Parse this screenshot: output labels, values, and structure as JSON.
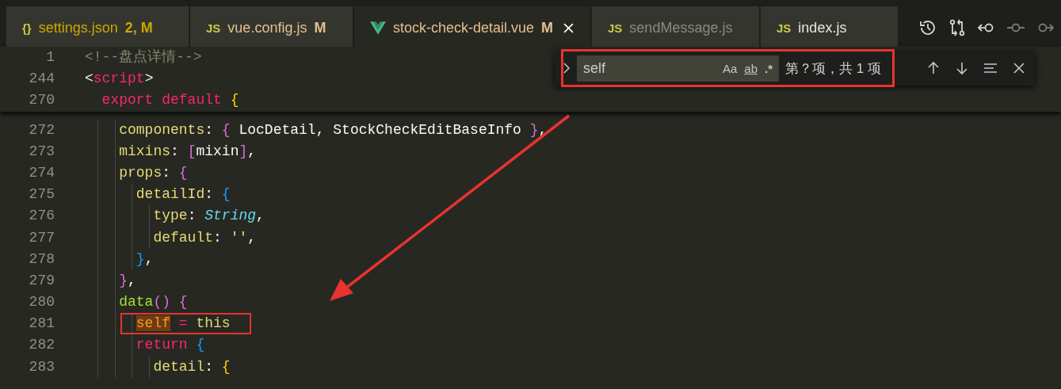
{
  "tabs": [
    {
      "icon": "{}",
      "kind": "json",
      "label": "settings.json",
      "badge": "2, M",
      "color": "#cca700",
      "selected": false
    },
    {
      "icon": "JS",
      "kind": "js",
      "label": "vue.config.js",
      "badge": "M",
      "color": "#e2c08d",
      "selected": false
    },
    {
      "kind": "vue",
      "label": "stock-check-detail.vue",
      "badge": "M",
      "color": "#e2c08d",
      "selected": true
    },
    {
      "icon": "JS",
      "kind": "js",
      "label": "sendMessage.js",
      "color": "#8a8a85",
      "selected": false
    },
    {
      "icon": "JS",
      "kind": "js",
      "label": "index.js",
      "color": "#e8e8e2",
      "selected": false
    }
  ],
  "toolbar": [
    {
      "kind": "history",
      "disabled": false
    },
    {
      "kind": "compare",
      "disabled": false
    },
    {
      "kind": "back",
      "disabled": false
    },
    {
      "kind": "commit",
      "disabled": true
    },
    {
      "kind": "forward",
      "disabled": true
    }
  ],
  "sticky_lines": [
    {
      "number": "1",
      "tokens": [
        {
          "kind": "comment",
          "text": "<!--盘点详情-->"
        }
      ]
    },
    {
      "number": "244",
      "tokens": [
        {
          "kind": "plain",
          "text": "<"
        },
        {
          "kind": "keyword",
          "text": "script"
        },
        {
          "kind": "plain",
          "text": ">"
        }
      ]
    },
    {
      "number": "270",
      "tokens": [
        {
          "kind": "keyword",
          "text": "  export default "
        },
        {
          "kind": "bracket1",
          "text": "{"
        }
      ]
    }
  ],
  "lines": [
    {
      "number": "272",
      "tokens": [
        {
          "kind": "property",
          "text": "    components"
        },
        {
          "kind": "plain",
          "text": ": "
        },
        {
          "kind": "bracket2",
          "text": "{"
        },
        {
          "kind": "plain",
          "text": " LocDetail, StockCheckEditBaseInfo "
        },
        {
          "kind": "bracket2",
          "text": "}"
        },
        {
          "kind": "plain",
          "text": ","
        }
      ]
    },
    {
      "number": "273",
      "tokens": [
        {
          "kind": "property",
          "text": "    mixins"
        },
        {
          "kind": "plain",
          "text": ": "
        },
        {
          "kind": "bracket2",
          "text": "["
        },
        {
          "kind": "plain",
          "text": "mixin"
        },
        {
          "kind": "bracket2",
          "text": "]"
        },
        {
          "kind": "plain",
          "text": ","
        }
      ]
    },
    {
      "number": "274",
      "tokens": [
        {
          "kind": "property",
          "text": "    props"
        },
        {
          "kind": "plain",
          "text": ": "
        },
        {
          "kind": "bracket2",
          "text": "{"
        }
      ]
    },
    {
      "number": "275",
      "tokens": [
        {
          "kind": "property",
          "text": "      detailId"
        },
        {
          "kind": "plain",
          "text": ": "
        },
        {
          "kind": "bracket3",
          "text": "{"
        }
      ]
    },
    {
      "number": "276",
      "tokens": [
        {
          "kind": "property",
          "text": "        type"
        },
        {
          "kind": "plain",
          "text": ": "
        },
        {
          "kind": "type",
          "text": "String"
        },
        {
          "kind": "plain",
          "text": ","
        }
      ]
    },
    {
      "number": "277",
      "tokens": [
        {
          "kind": "property",
          "text": "        default"
        },
        {
          "kind": "plain",
          "text": ": "
        },
        {
          "kind": "string",
          "text": "''"
        },
        {
          "kind": "plain",
          "text": ","
        }
      ]
    },
    {
      "number": "278",
      "tokens": [
        {
          "kind": "bracket3",
          "text": "      }"
        },
        {
          "kind": "plain",
          "text": ","
        }
      ]
    },
    {
      "number": "279",
      "tokens": [
        {
          "kind": "bracket2",
          "text": "    }"
        },
        {
          "kind": "plain",
          "text": ","
        }
      ]
    },
    {
      "number": "280",
      "tokens": [
        {
          "kind": "function",
          "text": "    data"
        },
        {
          "kind": "bracket2",
          "text": "()"
        },
        {
          "kind": "bracket2",
          "text": " {"
        }
      ]
    },
    {
      "number": "281",
      "annotated": true,
      "tokens": [
        {
          "kind": "match",
          "text": "      self"
        },
        {
          "kind": "keyword",
          "text": " = "
        },
        {
          "kind": "property",
          "text": "this"
        }
      ]
    },
    {
      "number": "282",
      "tokens": [
        {
          "kind": "keyword",
          "text": "      return "
        },
        {
          "kind": "bracket3",
          "text": "{"
        }
      ]
    },
    {
      "number": "283",
      "tokens": [
        {
          "kind": "property",
          "text": "        detail"
        },
        {
          "kind": "plain",
          "text": ": "
        },
        {
          "kind": "bracket1",
          "text": "{"
        }
      ]
    }
  ],
  "find": {
    "annotated": true,
    "value": "self",
    "options": [
      {
        "label": "Aa",
        "kind": "case",
        "on": false
      },
      {
        "label": "ab",
        "kind": "word",
        "on": false
      },
      {
        "label": ".*",
        "kind": "regex",
        "on": false
      }
    ],
    "count": "第？项，共 1 项"
  }
}
